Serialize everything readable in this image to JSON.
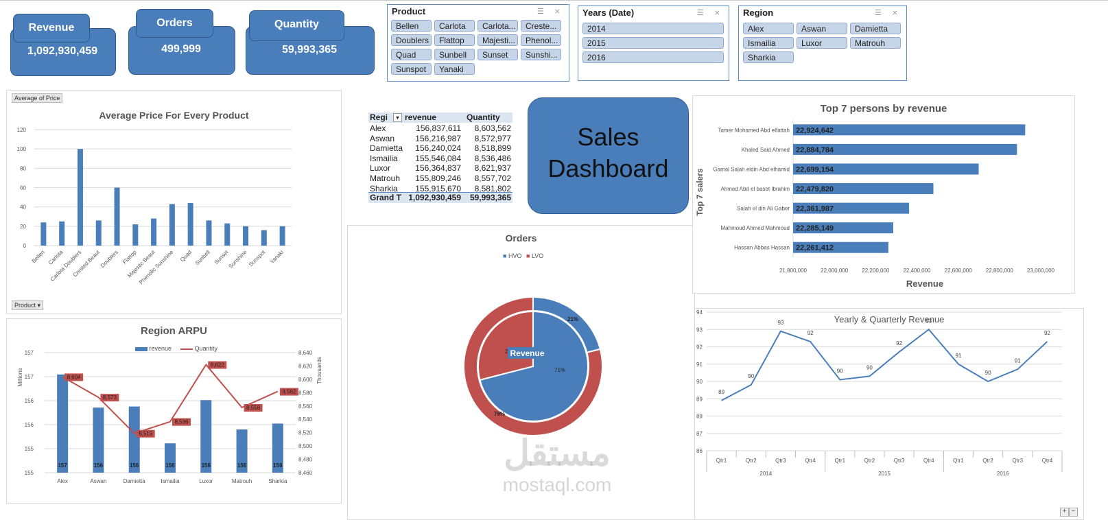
{
  "kpis": [
    {
      "label": "Revenue",
      "value": "1,092,930,459"
    },
    {
      "label": "Orders",
      "value": "499,999"
    },
    {
      "label": "Quantity",
      "value": "59,993,365"
    }
  ],
  "slicers": {
    "product": {
      "title": "Product",
      "items": [
        "Bellen",
        "Carlota",
        "Carlota...",
        "Creste...",
        "Doublers",
        "Flattop",
        "Majesti...",
        "Phenol...",
        "Quad",
        "Sunbell",
        "Sunset",
        "Sunshi...",
        "Sunspot",
        "Yanaki"
      ]
    },
    "years": {
      "title": "Years (Date)",
      "items": [
        "2014",
        "2015",
        "2016"
      ]
    },
    "region": {
      "title": "Region",
      "items": [
        "Alex",
        "Aswan",
        "Damietta",
        "Ismailia",
        "Luxor",
        "Matrouh",
        "Sharkia"
      ]
    }
  },
  "pivot": {
    "headers": [
      "Regi",
      "revenue",
      "Quantity"
    ],
    "rows": [
      [
        "Alex",
        "156,837,611",
        "8,603,562"
      ],
      [
        "Aswan",
        "156,216,987",
        "8,572,977"
      ],
      [
        "Damietta",
        "156,240,024",
        "8,518,899"
      ],
      [
        "Ismailia",
        "155,546,084",
        "8,536,486"
      ],
      [
        "Luxor",
        "156,364,837",
        "8,621,937"
      ],
      [
        "Matrouh",
        "155,809,246",
        "8,557,702"
      ],
      [
        "Sharkia",
        "155,915,670",
        "8,581,802"
      ]
    ],
    "total": [
      "Grand T",
      "1,092,930,459",
      "59,993,365"
    ]
  },
  "sales_title": {
    "line1": "Sales",
    "line2": "Dashboard"
  },
  "avg_price_chart": {
    "field_button": "Average of Price",
    "axis_button": "Product"
  },
  "watermark": {
    "arabic": "مستقل",
    "latin": "mostaql.com"
  },
  "colors": {
    "blue": "#4a7ebb",
    "red": "#c0504d",
    "grid": "#d9d9d9"
  },
  "chart_data": [
    {
      "id": "avg_price",
      "type": "bar",
      "title": "Average Price For Every Product",
      "categories": [
        "Bellen",
        "Carlota",
        "Carlota Doublers",
        "Crested Beaut",
        "Doublers",
        "Flattop",
        "Majestic Beaut",
        "Phenolic Sunshine",
        "Quad",
        "Sunbell",
        "Sunset",
        "Sunshine",
        "Sunspot",
        "Yanaki"
      ],
      "values": [
        24,
        25,
        100,
        26,
        60,
        22,
        28,
        43,
        44,
        26,
        23,
        20,
        16,
        20
      ],
      "yticks": [
        "0",
        "20",
        "40",
        "60",
        "80",
        "100",
        "120"
      ],
      "ylim": [
        0,
        120
      ]
    },
    {
      "id": "region_arpu",
      "type": "bar",
      "title": "Region ARPU",
      "categories": [
        "Alex",
        "Aswan",
        "Damietta",
        "Ismailia",
        "Luxor",
        "Matrouh",
        "Sharkia"
      ],
      "series": [
        {
          "name": "revenue",
          "values": [
            156.84,
            156.22,
            156.24,
            155.55,
            156.36,
            155.81,
            155.92
          ],
          "labels": [
            "157",
            "156",
            "156",
            "156",
            "156",
            "156",
            "156"
          ]
        },
        {
          "name": "Quantity",
          "values": [
            8603.562,
            8572.977,
            8518.899,
            8536.486,
            8621.937,
            8557.702,
            8581.802
          ],
          "labels": [
            "8,604",
            "8,573",
            "8,519",
            "8,536",
            "8,622",
            "8,558",
            "8,582"
          ]
        }
      ],
      "y_left_label": "Millions",
      "y_right_label": "Thousands",
      "y_left_ticks": [
        "155",
        "155",
        "156",
        "156",
        "157",
        "157"
      ],
      "y_left_lim": [
        155,
        157.25
      ],
      "y_right_ticks": [
        "8,460",
        "8,480",
        "8,500",
        "8,520",
        "8,540",
        "8,560",
        "8,580",
        "8,600",
        "8,620",
        "8,640"
      ],
      "y_right_lim": [
        8460,
        8640
      ]
    },
    {
      "id": "orders",
      "type": "pie",
      "title": "Orders",
      "legend": [
        "HVO",
        "LVO"
      ],
      "inner": {
        "name": "Revenue",
        "values": [
          71,
          29
        ],
        "labels": [
          "71%",
          "29%"
        ]
      },
      "outer": {
        "values": [
          21,
          79
        ],
        "labels": [
          "21%",
          "79%"
        ]
      }
    },
    {
      "id": "top7",
      "type": "bar",
      "title": "Top 7 persons by revenue",
      "ylabel": "Top 7 salers",
      "xlabel": "Revenue",
      "categories": [
        "Tamer Mohamed Abd elfattah",
        "Khaled Said Ahmed",
        "Gamal Salah eldin Abd elhamid",
        "Ahmed Abd el baset Ibrahim",
        "Salah el din Ali Gaber",
        "Mahmoud Ahmed Mahmoud",
        "Hassan Abbas Hassan"
      ],
      "values": [
        22924642,
        22884784,
        22699154,
        22479820,
        22361987,
        22285149,
        22261412
      ],
      "labels": [
        "22,924,642",
        "22,884,784",
        "22,699,154",
        "22,479,820",
        "22,361,987",
        "22,285,149",
        "22,261,412"
      ],
      "xticks": [
        "21,800,000",
        "22,000,000",
        "22,200,000",
        "22,400,000",
        "22,600,000",
        "22,800,000",
        "23,000,000"
      ],
      "xlim": [
        21800000,
        23000000
      ]
    },
    {
      "id": "yearly",
      "type": "line",
      "title": "Yearly & Quarterly Revenue",
      "quarters": [
        "Qtr1",
        "Qtr2",
        "Qtr3",
        "Qtr4",
        "Qtr1",
        "Qtr2",
        "Qtr3",
        "Qtr4",
        "Qtr1",
        "Qtr2",
        "Qtr3",
        "Qtr4"
      ],
      "years": [
        "2014",
        "2015",
        "2016"
      ],
      "values": [
        88.9,
        89.8,
        92.9,
        92.3,
        90.1,
        90.3,
        91.7,
        93.0,
        91.0,
        90.0,
        90.7,
        92.3
      ],
      "labels": [
        "89",
        "90",
        "93",
        "92",
        "90",
        "90",
        "92",
        "93",
        "91",
        "90",
        "91",
        "92"
      ],
      "yticks": [
        "86",
        "87",
        "88",
        "89",
        "90",
        "91",
        "92",
        "93",
        "94"
      ],
      "ylim": [
        86,
        94
      ]
    }
  ]
}
